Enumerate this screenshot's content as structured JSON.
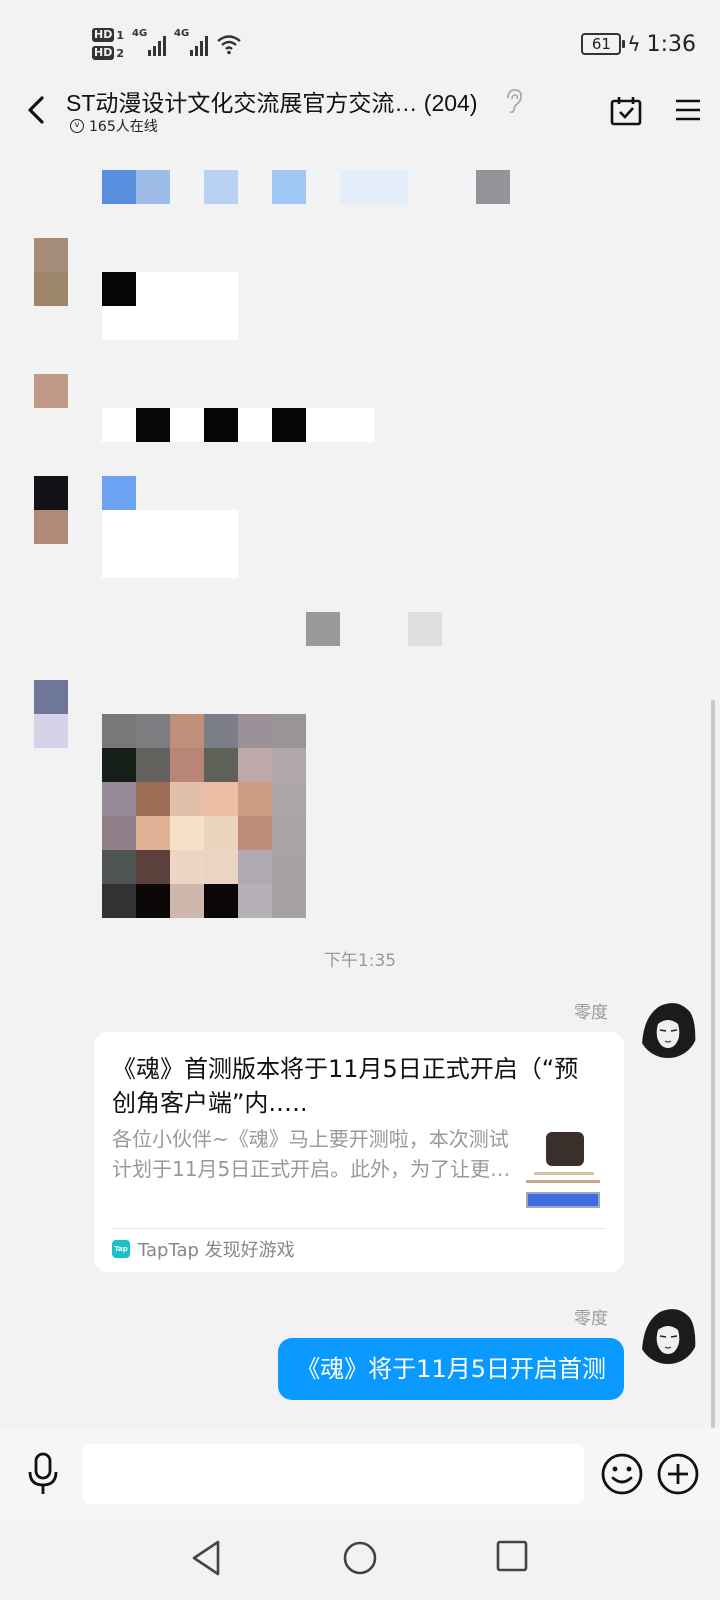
{
  "status_bar": {
    "sim1": "HD",
    "sim1_num": "1",
    "sim2": "HD",
    "sim2_num": "2",
    "net1": "4G",
    "net2": "4G",
    "battery": "61",
    "time": "1:36"
  },
  "header": {
    "title": "ST动漫设计文化交流展官方交流…",
    "count": "(204)",
    "online": "165人在线"
  },
  "messages": {
    "timestamp": "下午1:35",
    "card": {
      "sender": "零度",
      "title": "《魂》首测版本将于11月5日正式开启（“预创角客户端”内.….",
      "description": "各位小伙伴~《魂》马上要开测啦，本次测试计划于11月5日正式开启。此外，为了让更…",
      "source": "TapTap 发现好游戏",
      "source_icon_text": "Tap"
    },
    "bubble": {
      "sender": "零度",
      "text": "《魂》将于11月5日开启首测"
    }
  },
  "colors": {
    "bubble": "#0a99ff",
    "background": "#f2f2f2",
    "taptap": "#17c3c9"
  },
  "icons": [
    "back-icon",
    "ear-icon",
    "calendar-check-icon",
    "menu-icon",
    "mic-icon",
    "emoji-icon",
    "plus-icon",
    "nav-back-icon",
    "nav-home-icon",
    "nav-recent-icon"
  ]
}
